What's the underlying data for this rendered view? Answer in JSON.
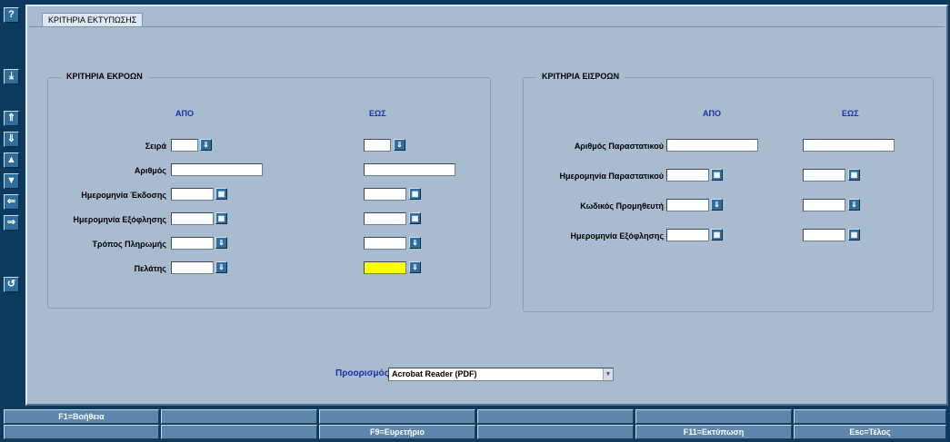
{
  "toolbar": {
    "help_glyph": "?",
    "buttons": [
      "help-icon",
      "download-icon",
      "first-record-icon",
      "next-record-down-icon",
      "previous-icon",
      "next-icon",
      "back-icon",
      "forward-icon",
      "return-icon"
    ]
  },
  "tab": {
    "label": "ΚΡΙΤΗΡΙΑ ΕΚΤΥΠΩΣΗΣ"
  },
  "outflows": {
    "title": "ΚΡΙΤΗΡΙΑ ΕΚΡΟΩΝ",
    "col_from": "ΑΠΟ",
    "col_to": "ΕΩΣ",
    "rows": [
      {
        "label": "Σειρά",
        "from_value": "",
        "to_value": ""
      },
      {
        "label": "Αριθμός",
        "from_value": "",
        "to_value": ""
      },
      {
        "label": "Ημερομηνία Έκδοσης",
        "from_value": "",
        "to_value": ""
      },
      {
        "label": "Ημερομηνία Εξόφλησης",
        "from_value": "",
        "to_value": ""
      },
      {
        "label": "Τρόπος Πληρωμής",
        "from_value": "",
        "to_value": ""
      },
      {
        "label": "Πελάτης",
        "from_value": "",
        "to_value": ""
      }
    ]
  },
  "inflows": {
    "title": "ΚΡΙΤΗΡΙΑ ΕΙΣΡΟΩΝ",
    "col_from": "ΑΠΟ",
    "col_to": "ΕΩΣ",
    "rows": [
      {
        "label": "Αριθμός Παραστατικού",
        "from_value": "",
        "to_value": ""
      },
      {
        "label": "Ημερομηνία Παραστατικού",
        "from_value": "",
        "to_value": ""
      },
      {
        "label": "Κωδικός Προμηθευτή",
        "from_value": "",
        "to_value": ""
      },
      {
        "label": "Ημερομηνία Εξόφλησης",
        "from_value": "",
        "to_value": ""
      }
    ]
  },
  "destination": {
    "label": "Προορισμός",
    "selected": "Acrobat Reader (PDF)"
  },
  "function_keys": {
    "row1": [
      "F1=Βοήθεια",
      "",
      "",
      "",
      "",
      ""
    ],
    "row2": [
      "",
      "",
      "F9=Ευρετήριο",
      "",
      "F11=Εκτύπωση",
      "Esc=Τέλος"
    ]
  },
  "colors": {
    "highlight_field": "#ffff00",
    "background": "#a9bccf",
    "frame": "#0c3a5c",
    "heading_blue": "#1f2fa8"
  }
}
